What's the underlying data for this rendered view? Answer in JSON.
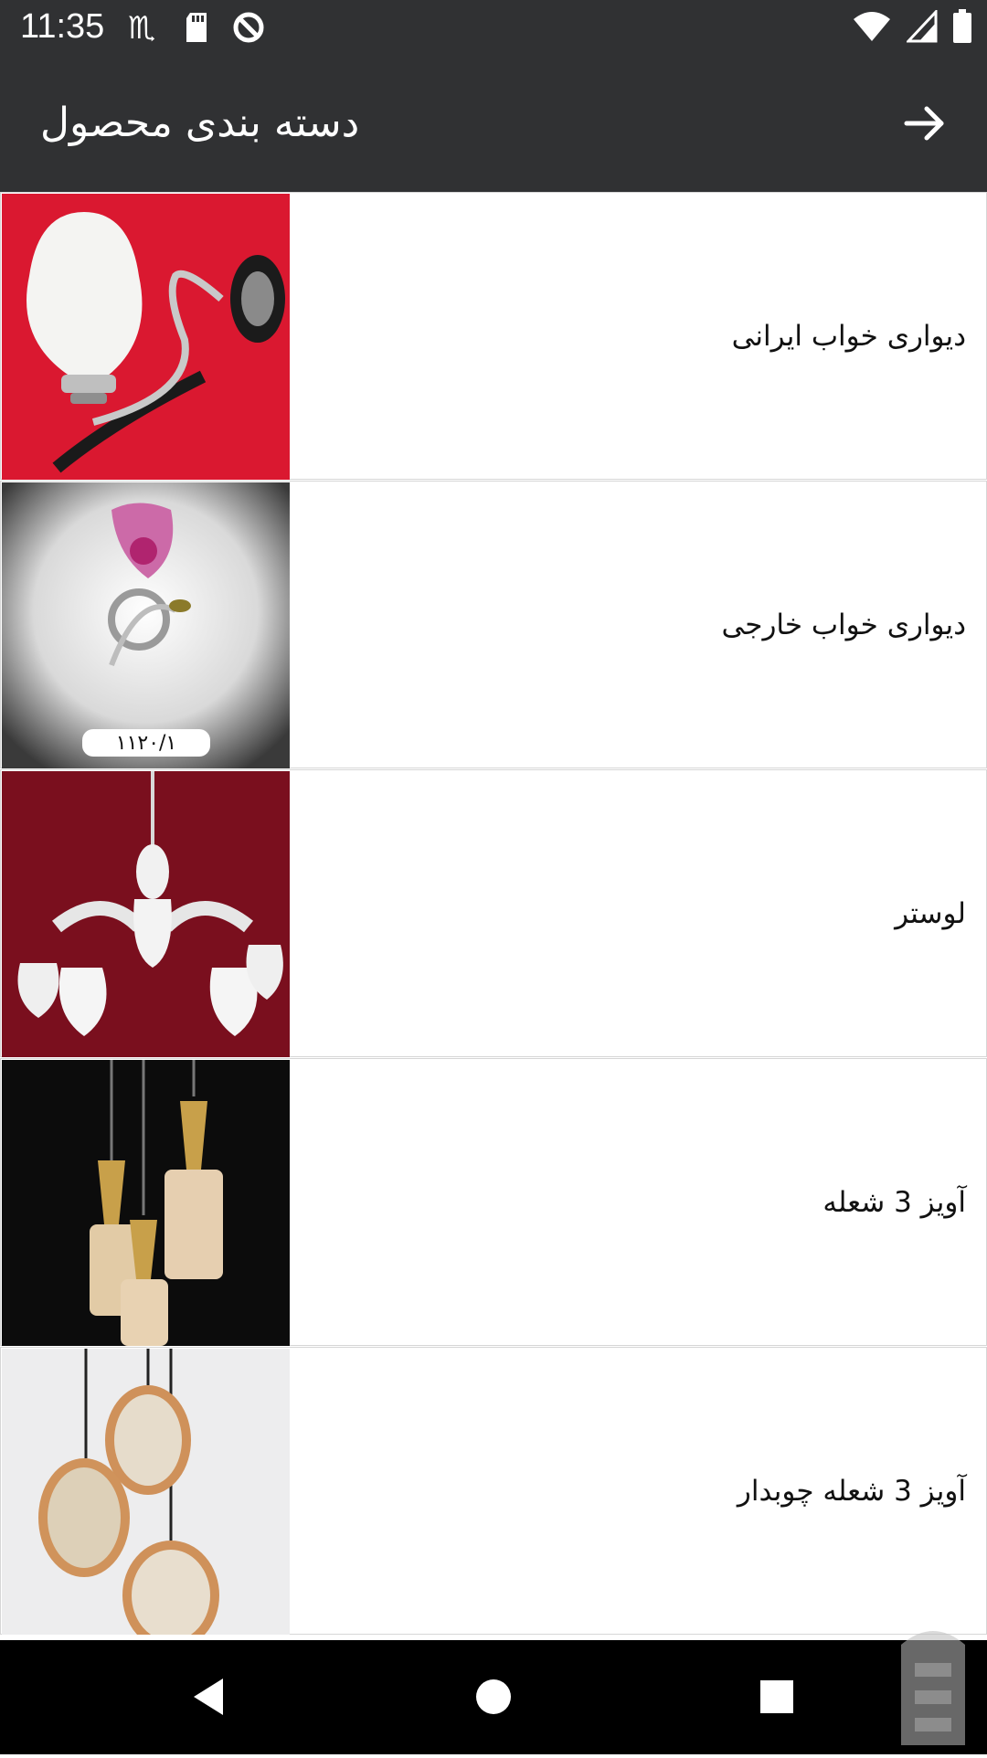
{
  "status_bar": {
    "time": "11:35",
    "left_icons": [
      "scorpio-icon",
      "sd-card-icon",
      "data-saver-icon"
    ],
    "right_icons": [
      "wifi-icon",
      "cell-signal-icon",
      "battery-icon"
    ]
  },
  "app_bar": {
    "title": "دسته بندی محصول",
    "back_icon": "arrow-right-icon"
  },
  "categories": [
    {
      "label": "دیواری خواب ایرانی",
      "image": "wall-lamp-white-on-red"
    },
    {
      "label": "دیواری خواب خارجی",
      "image": "wall-lamp-pink-tulip",
      "image_caption": "۱۱۲۰/۱"
    },
    {
      "label": "لوستر",
      "image": "chandelier-white-on-maroon"
    },
    {
      "label": "آویز 3 شعله",
      "image": "gold-pendant-lamps-on-black"
    },
    {
      "label": "آویز 3 شعله چوبدار",
      "image": "wooden-pendant-lamps-on-white"
    }
  ],
  "nav_bar": {
    "buttons": [
      "back-triangle-icon",
      "home-circle-icon",
      "recents-square-icon"
    ]
  },
  "colors": {
    "app_bar": "#303133",
    "nav_bar": "#000000",
    "divider": "#d6d6d6"
  }
}
